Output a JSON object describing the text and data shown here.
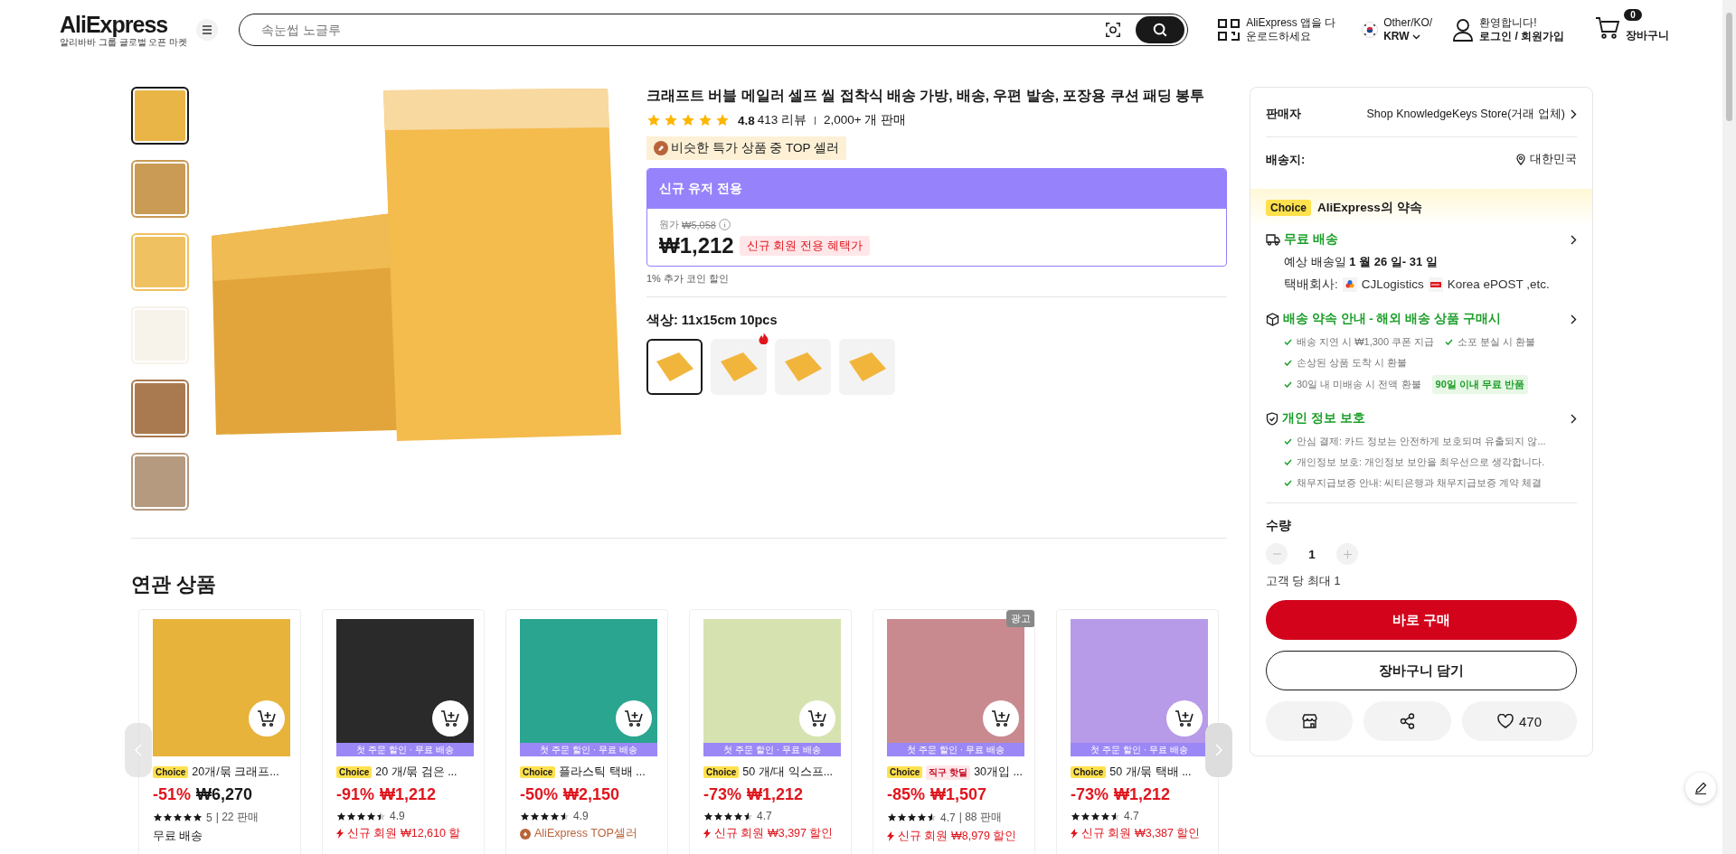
{
  "header": {
    "logo": "AliExpress",
    "tagline": "알리바바 그룹 글로벌 오픈 마켓",
    "search": {
      "placeholder": "속눈썹 노글루"
    },
    "app_promo": "AliExpress 앱을 다운로드하세요",
    "locale": {
      "region": "Other/KO/",
      "currency": "KRW"
    },
    "account": {
      "greeting": "환영합니다!",
      "links": "로그인 / 회원가입"
    },
    "cart": {
      "count": "0",
      "label": "장바구니"
    }
  },
  "gallery": {
    "thumbnails": [
      {
        "selected": true
      },
      {
        "selected": false
      },
      {
        "selected": false
      },
      {
        "selected": false
      },
      {
        "selected": false
      },
      {
        "selected": false
      }
    ]
  },
  "product": {
    "title": "크래프트 버블 메일러 셀프 씰 접착식 배송 가방, 배송, 우편 발송, 포장용 쿠션 패딩 봉투",
    "rating": {
      "stars": 5,
      "score": "4.8",
      "reviews": "413 리뷰",
      "sold": "2,000+ 개 판매"
    },
    "badge": "비슷한 특가 상품 중 TOP 셀러",
    "promo": {
      "header": "신규 유저 전용",
      "original_label": "원가",
      "original_price": "₩5,058",
      "price": "₩1,212",
      "tag": "신규 회원 전용 혜택가"
    },
    "coin_note": "1% 추가 코인 할인",
    "color_label": "색상: 11x15cm 10pcs",
    "variants": [
      {
        "selected": true,
        "hot": false
      },
      {
        "selected": false,
        "hot": true
      },
      {
        "selected": false,
        "hot": false
      },
      {
        "selected": false,
        "hot": false
      }
    ]
  },
  "panel": {
    "seller": {
      "label": "판매자",
      "value": "Shop KnowledgeKeys Store(거래 업체)"
    },
    "ship_to": {
      "label": "배송지:",
      "value": "대한민국"
    },
    "choice": {
      "badge": "Choice",
      "title": "AliExpress의 약속"
    },
    "sections": [
      {
        "kind": "shipping",
        "title": "무료 배송",
        "date": "예상 배송일 **1 월 26 일- 31 일**",
        "courier_label": "택배회사:",
        "carriers": [
          "CJLogistics",
          "Korea ePOST ,etc."
        ]
      },
      {
        "kind": "promise",
        "title": "배송 약속 안내 - 해외 배송 상품 구매시",
        "rows": [
          [
            {
              "kind": "check",
              "text": "배송 지연 시 ₩1,300 쿠폰 지급"
            },
            {
              "kind": "check",
              "text": "소포 분실 시 환불"
            }
          ],
          [
            {
              "kind": "check",
              "text": "손상된 상품 도착 시 환불"
            }
          ],
          [
            {
              "kind": "check",
              "text": "30일 내 미배송 시 전액 환불"
            },
            {
              "kind": "tag",
              "text": "90일 이내 무료 반품"
            }
          ]
        ]
      },
      {
        "kind": "privacy",
        "title": "개인 정보 보호",
        "rows": [
          [
            {
              "kind": "check",
              "text": "안심 결제: 카드 정보는 안전하게 보호되며 유출되지 않..."
            }
          ],
          [
            {
              "kind": "check",
              "text": "개인정보 보호: 개인정보 보안을 최우선으로 생각합니다."
            }
          ],
          [
            {
              "kind": "check",
              "text": "채무지급보증 안내: 씨티은행과 채무지급보증 계약 체결"
            }
          ]
        ]
      }
    ],
    "quantity": {
      "label": "수량",
      "value": "1",
      "limit": "고객 당 최대 1"
    },
    "buy_now": "바로 구매",
    "add_to_cart": "장바구니 담기",
    "wishlist_count": "470"
  },
  "related": {
    "title": "연관 상품",
    "cards": [
      {
        "choice": "Choice",
        "title": "20개/묶 크래프...",
        "discount": "-51%",
        "price": "₩6,270",
        "price_highlight": false,
        "stars": 5,
        "rating": "5",
        "sold": "| 22 판매",
        "extra": {
          "kind": "plain",
          "text": "무료 배송"
        }
      },
      {
        "banner": "첫 주문 할인 · 무료 배송",
        "choice": "Choice",
        "title": "20 개/묶 검은 ...",
        "discount": "-91%",
        "price": "₩1,212",
        "price_highlight": true,
        "stars": 4.5,
        "rating": "4.9",
        "extra": {
          "kind": "coupon",
          "text": "신규 회원 ₩12,610 할"
        }
      },
      {
        "banner": "첫 주문 할인 · 무료 배송",
        "choice": "Choice",
        "title": "플라스틱 택배 ...",
        "discount": "-50%",
        "price": "₩2,150",
        "price_highlight": true,
        "stars": 4.5,
        "rating": "4.9",
        "extra": {
          "kind": "seller",
          "text": "AliExpress TOP셀러"
        }
      },
      {
        "banner": "첫 주문 할인 · 무료 배송",
        "choice": "Choice",
        "title": "50 개/대 익스프...",
        "discount": "-73%",
        "price": "₩1,212",
        "price_highlight": true,
        "stars": 4.5,
        "rating": "4.7",
        "extra": {
          "kind": "coupon",
          "text": "신규 회원 ₩3,397 할인"
        }
      },
      {
        "ad": "광고",
        "banner": "첫 주문 할인 · 무료 배송",
        "choice": "Choice",
        "tag": "직구 핫딜",
        "title": "30개입 ...",
        "discount": "-85%",
        "price": "₩1,507",
        "price_highlight": true,
        "stars": 4.5,
        "rating": "4.7",
        "sold": "| 88 판매",
        "extra": {
          "kind": "coupon",
          "text": "신규 회원 ₩8,979 할인"
        }
      },
      {
        "banner": "첫 주문 할인 · 무료 배송",
        "choice": "Choice",
        "title": "50 개/묶 택배 ...",
        "discount": "-73%",
        "price": "₩1,212",
        "price_highlight": true,
        "stars": 4.5,
        "rating": "4.7",
        "extra": {
          "kind": "coupon",
          "text": "신규 회원 ₩3,387 할인"
        }
      }
    ]
  }
}
